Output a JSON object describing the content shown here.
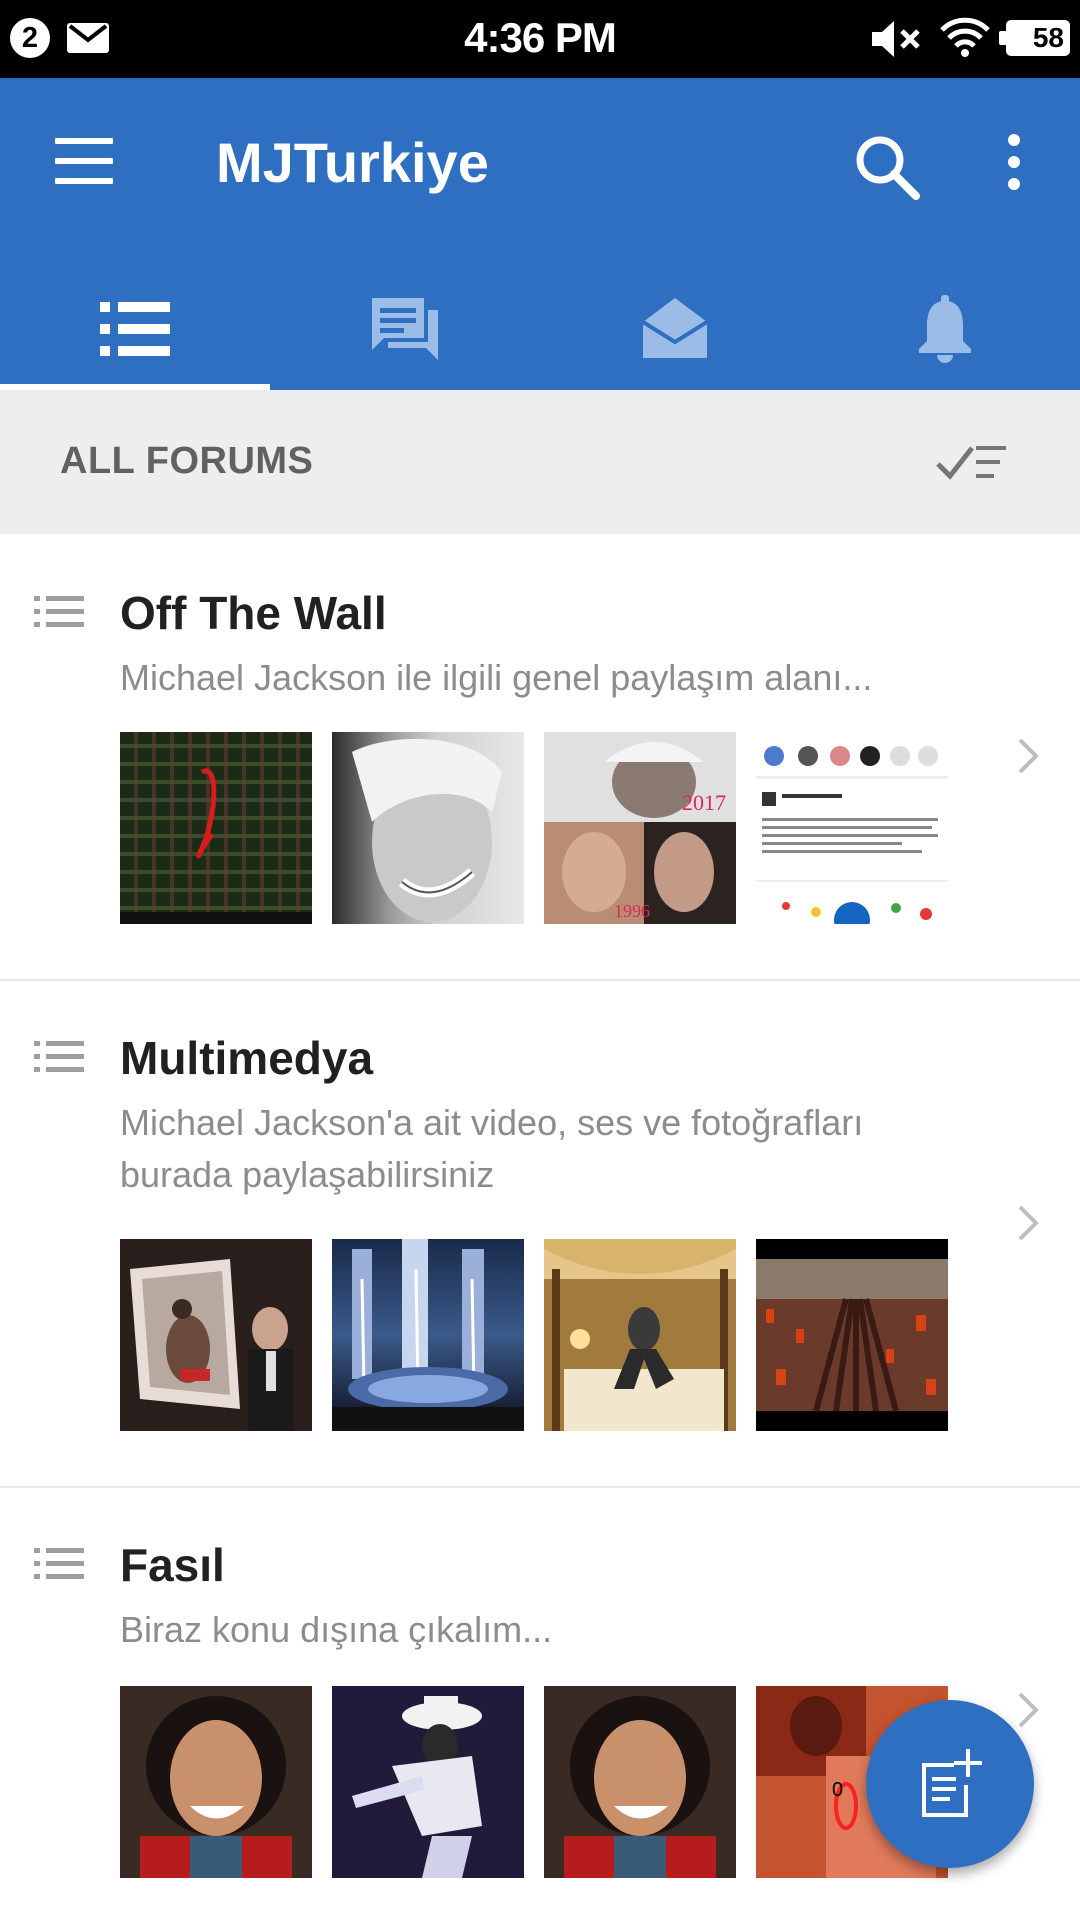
{
  "status_bar": {
    "notification_count": "2",
    "time": "4:36 PM",
    "battery": "58"
  },
  "app_bar": {
    "title": "MJTurkiye",
    "tabs": [
      {
        "icon": "forum-list-icon",
        "selected": true
      },
      {
        "icon": "topics-icon",
        "selected": false
      },
      {
        "icon": "messages-icon",
        "selected": false
      },
      {
        "icon": "notifications-icon",
        "selected": false
      }
    ]
  },
  "section": {
    "title": "ALL FORUMS"
  },
  "forums": [
    {
      "name": "Off The Wall",
      "description": "Michael Jackson ile ilgili genel paylaşım alanı..."
    },
    {
      "name": "Multimedya",
      "description": "Michael Jackson'a ait video, ses ve fotoğrafları burada paylaşabilirsiniz"
    },
    {
      "name": "Fasıl",
      "description": "Biraz konu dışına çıkalım..."
    }
  ],
  "colors": {
    "primary": "#2f6fc1",
    "section_bg": "#eeeeee",
    "text_primary": "#212121",
    "text_secondary": "#8c8c8c"
  }
}
